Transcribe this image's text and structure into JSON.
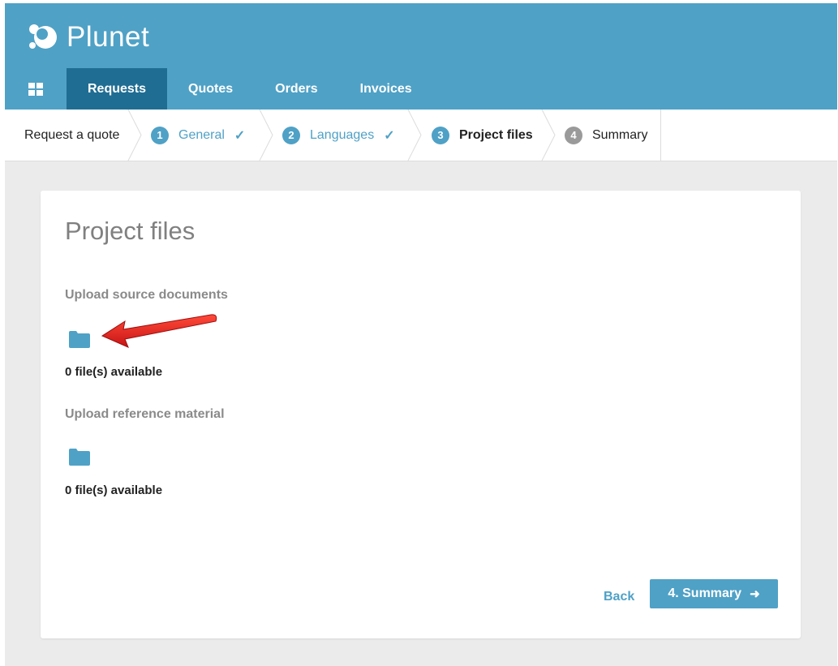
{
  "app": {
    "name": "Plunet"
  },
  "nav": {
    "tabs": [
      {
        "label": "Requests",
        "active": true
      },
      {
        "label": "Quotes",
        "active": false
      },
      {
        "label": "Orders",
        "active": false
      },
      {
        "label": "Invoices",
        "active": false
      }
    ]
  },
  "wizard": {
    "title": "Request a quote",
    "steps": [
      {
        "number": "1",
        "label": "General",
        "state": "done"
      },
      {
        "number": "2",
        "label": "Languages",
        "state": "done"
      },
      {
        "number": "3",
        "label": "Project files",
        "state": "current"
      },
      {
        "number": "4",
        "label": "Summary",
        "state": "upcoming"
      }
    ],
    "check_glyph": "✓"
  },
  "page": {
    "title": "Project files",
    "source_label": "Upload source documents",
    "source_count": "0 file(s) available",
    "reference_label": "Upload reference material",
    "reference_count": "0 file(s) available"
  },
  "actions": {
    "back_label": "Back",
    "next_label": "4. Summary",
    "next_arrow": "➜"
  },
  "icons": {
    "grid": "grid-icon",
    "folder": "folder-icon",
    "check": "checkmark-icon",
    "arrow": "arrow-right-icon",
    "annotation": "red-arrow-annotation-icon"
  },
  "colors": {
    "brand": "#4fa1c6",
    "nav_active": "#1f6d93",
    "step_done": "#4fa1c6",
    "step_upcoming": "#9a9a9a",
    "annotation": "#e32222"
  }
}
